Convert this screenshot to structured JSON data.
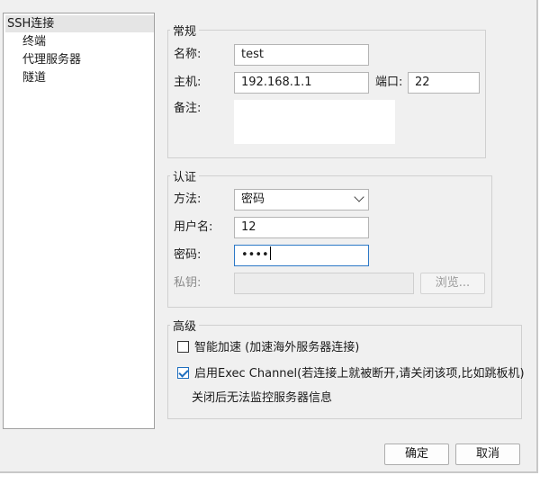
{
  "sidebar": {
    "items": [
      {
        "label": "SSH连接",
        "selected": true
      },
      {
        "label": "终端"
      },
      {
        "label": "代理服务器"
      },
      {
        "label": "隧道"
      }
    ]
  },
  "general": {
    "title": "常规",
    "name_label": "名称:",
    "name_value": "test",
    "host_label": "主机:",
    "host_value": "192.168.1.1",
    "port_label": "端口:",
    "port_value": "22",
    "note_label": "备注:",
    "note_value": ""
  },
  "auth": {
    "title": "认证",
    "method_label": "方法:",
    "method_value": "密码",
    "user_label": "用户名:",
    "user_value": "12",
    "password_label": "密码:",
    "password_value": "••••",
    "key_label": "私钥:",
    "key_value": "",
    "browse_label": "浏览..."
  },
  "advanced": {
    "title": "高级",
    "smart_accel_label": "智能加速 (加速海外服务器连接)",
    "smart_accel_checked": false,
    "exec_channel_label": "启用Exec Channel(若连接上就被断开,请关闭该项,比如跳板机)",
    "exec_channel_checked": true,
    "exec_channel_note": "关闭后无法监控服务器信息"
  },
  "footer": {
    "ok_label": "确定",
    "cancel_label": "取消"
  },
  "colors": {
    "focus_border": "#2b78c6",
    "checkbox_accent": "#1f6fbf"
  }
}
